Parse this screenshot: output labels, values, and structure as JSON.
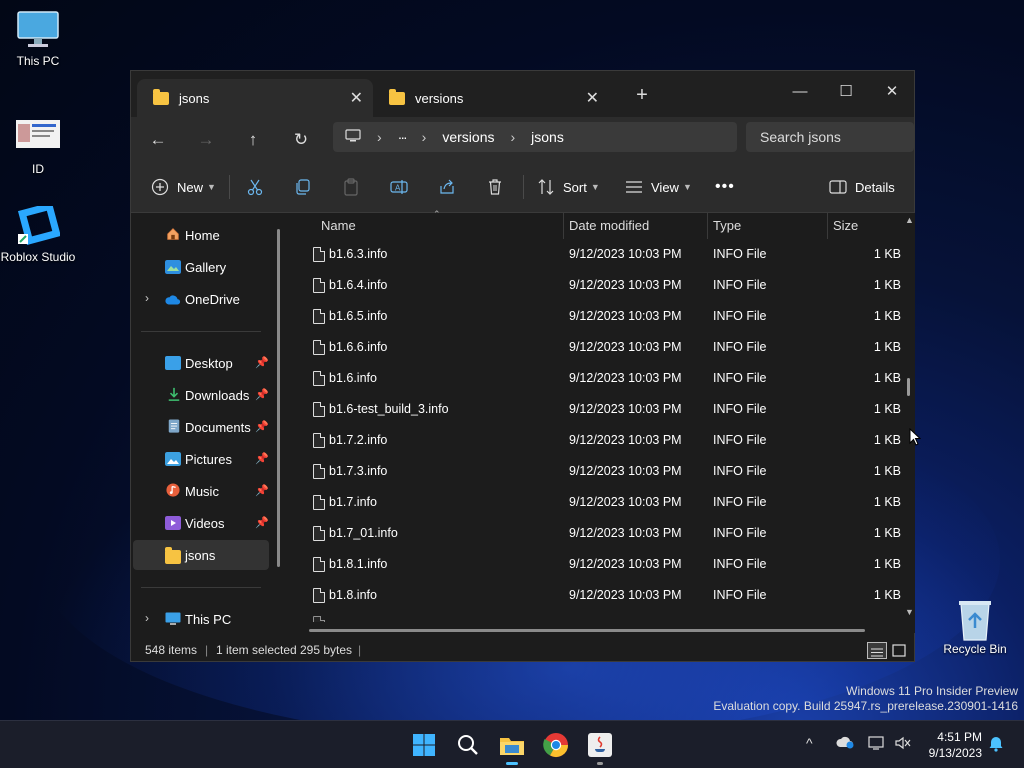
{
  "desktop": {
    "icons": [
      {
        "label": "This PC"
      },
      {
        "label": "ID"
      },
      {
        "label": "Roblox Studio"
      },
      {
        "label": "Recycle Bin"
      }
    ]
  },
  "explorer": {
    "tabs": [
      {
        "label": "jsons",
        "active": true
      },
      {
        "label": "versions",
        "active": false
      }
    ],
    "new_tab_glyph": "+",
    "window_controls": {
      "minimize": "—",
      "maximize": "☐",
      "close": "✕"
    },
    "breadcrumb": [
      "versions",
      "jsons"
    ],
    "breadcrumb_ellipsis": "···",
    "search": {
      "placeholder": "Search jsons"
    },
    "toolbar": {
      "new_label": "New",
      "sort_label": "Sort",
      "view_label": "View",
      "details_label": "Details",
      "more_glyph": "•••"
    },
    "nav": {
      "items": [
        {
          "label": "Home",
          "icon": "home-icon"
        },
        {
          "label": "Gallery",
          "icon": "gallery-icon"
        },
        {
          "label": "OneDrive",
          "icon": "onedrive-icon"
        },
        {
          "label": "Desktop",
          "icon": "desktop-icon",
          "pinned": true
        },
        {
          "label": "Downloads",
          "icon": "downloads-icon",
          "pinned": true
        },
        {
          "label": "Documents",
          "icon": "documents-icon",
          "pinned": true
        },
        {
          "label": "Pictures",
          "icon": "pictures-icon",
          "pinned": true
        },
        {
          "label": "Music",
          "icon": "music-icon",
          "pinned": true
        },
        {
          "label": "Videos",
          "icon": "videos-icon",
          "pinned": true
        },
        {
          "label": "jsons",
          "icon": "folder-icon",
          "selected": true
        },
        {
          "label": "This PC",
          "icon": "this-pc-icon"
        }
      ]
    },
    "columns": {
      "name": "Name",
      "date": "Date modified",
      "type": "Type",
      "size": "Size"
    },
    "files": [
      {
        "name": "b1.6.3.info",
        "date": "9/12/2023 10:03 PM",
        "type": "INFO File",
        "size": "1 KB"
      },
      {
        "name": "b1.6.4.info",
        "date": "9/12/2023 10:03 PM",
        "type": "INFO File",
        "size": "1 KB"
      },
      {
        "name": "b1.6.5.info",
        "date": "9/12/2023 10:03 PM",
        "type": "INFO File",
        "size": "1 KB"
      },
      {
        "name": "b1.6.6.info",
        "date": "9/12/2023 10:03 PM",
        "type": "INFO File",
        "size": "1 KB"
      },
      {
        "name": "b1.6.info",
        "date": "9/12/2023 10:03 PM",
        "type": "INFO File",
        "size": "1 KB"
      },
      {
        "name": "b1.6-test_build_3.info",
        "date": "9/12/2023 10:03 PM",
        "type": "INFO File",
        "size": "1 KB"
      },
      {
        "name": "b1.7.2.info",
        "date": "9/12/2023 10:03 PM",
        "type": "INFO File",
        "size": "1 KB"
      },
      {
        "name": "b1.7.3.info",
        "date": "9/12/2023 10:03 PM",
        "type": "INFO File",
        "size": "1 KB"
      },
      {
        "name": "b1.7.info",
        "date": "9/12/2023 10:03 PM",
        "type": "INFO File",
        "size": "1 KB"
      },
      {
        "name": "b1.7_01.info",
        "date": "9/12/2023 10:03 PM",
        "type": "INFO File",
        "size": "1 KB"
      },
      {
        "name": "b1.8.1.info",
        "date": "9/12/2023 10:03 PM",
        "type": "INFO File",
        "size": "1 KB"
      },
      {
        "name": "b1.8.info",
        "date": "9/12/2023 10:03 PM",
        "type": "INFO File",
        "size": "1 KB"
      }
    ],
    "status": {
      "count": "548 items",
      "selection": "1 item selected",
      "size": "295 bytes"
    }
  },
  "watermark": {
    "line1": "Windows 11 Pro Insider Preview",
    "line2": "Evaluation copy. Build 25947.rs_prerelease.230901-1416"
  },
  "taskbar": {
    "apps": [
      "start-icon",
      "search-icon",
      "file-explorer-icon",
      "chrome-icon",
      "java-icon"
    ],
    "tray_chevron": "^",
    "clock": {
      "time": "4:51 PM",
      "date": "9/13/2023"
    }
  },
  "colors": {
    "folder": "#f7c342",
    "accent": "#4cc2ff",
    "window_bg": "#1c1c1c",
    "toolbar_bg": "#2c2c2c"
  }
}
